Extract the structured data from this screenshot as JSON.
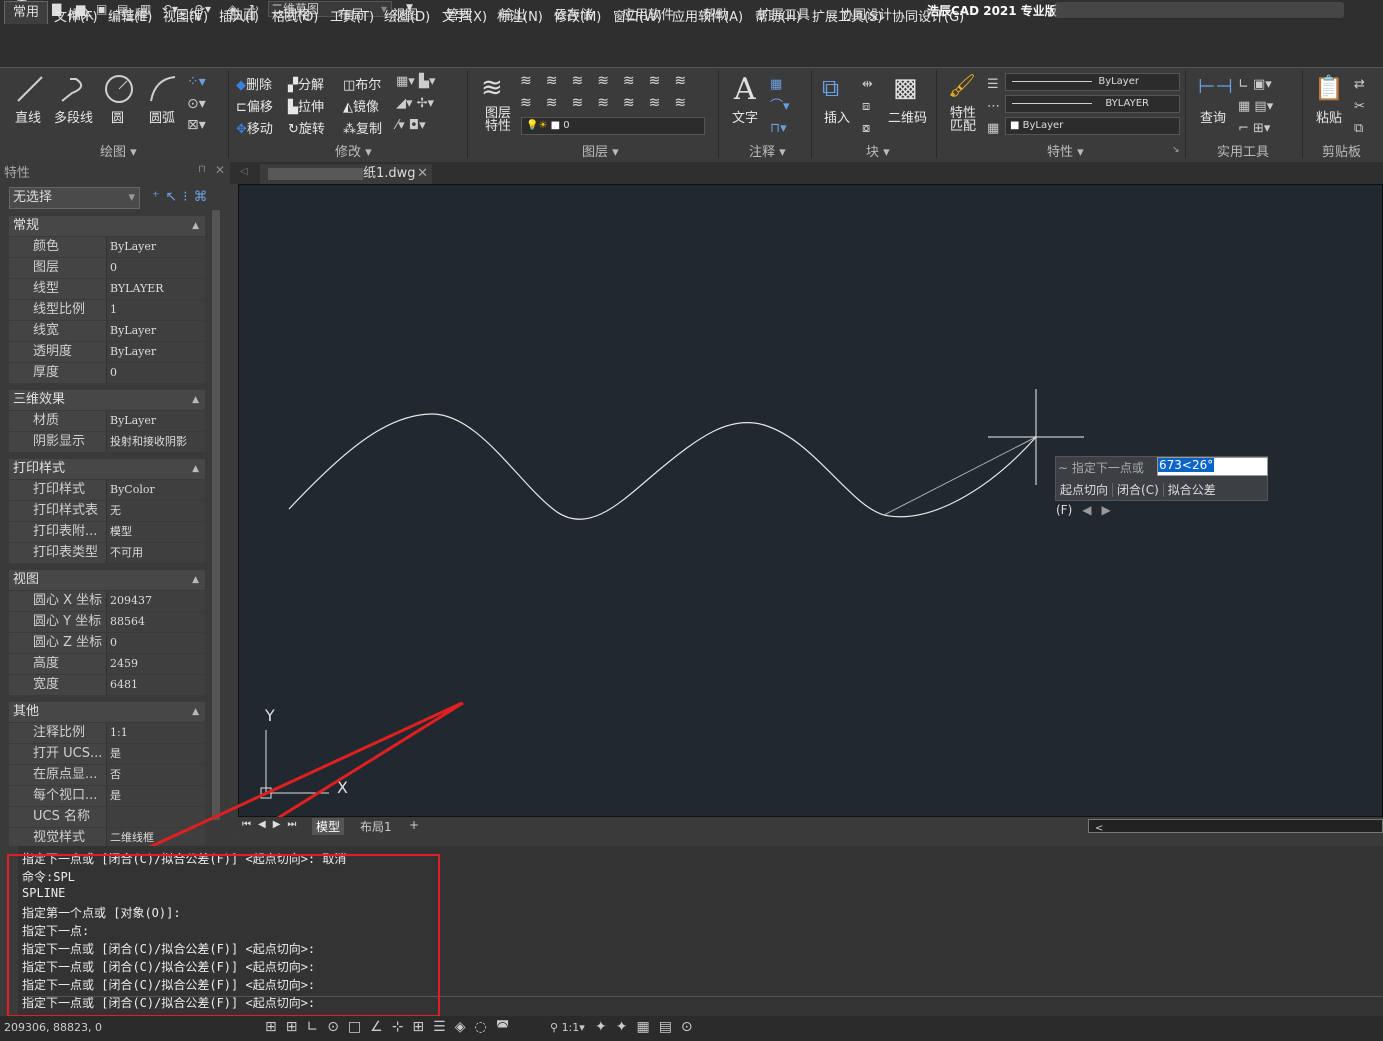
{
  "window": {
    "app_title": "浩辰CAD 2021 专业版",
    "workspace": "二维草图",
    "logo": "G"
  },
  "menu": [
    "文件(F)",
    "编辑(E)",
    "视图(V)",
    "插入(I)",
    "格式(O)",
    "工具(T)",
    "绘图(D)",
    "文字(X)",
    "标注(N)",
    "修改(M)",
    "窗口(W)",
    "应用软件(A)",
    "帮助(H)",
    "扩展工具(S)",
    "协同设计(G)"
  ],
  "tabs": [
    "常用",
    "插入",
    "注释",
    "三维",
    "曲面",
    "网格",
    "布局",
    "视图",
    "管理",
    "输出",
    "云存储",
    "应用软件",
    "帮助",
    "扩展工具",
    "协同设计"
  ],
  "ribbon": {
    "draw": {
      "title": "绘图",
      "line": "直线",
      "pline": "多段线",
      "circle": "圆",
      "arc": "圆弧"
    },
    "modify": {
      "title": "修改",
      "erase": "删除",
      "explode": "分解",
      "boolean": "布尔",
      "offset": "偏移",
      "stretch": "拉伸",
      "mirror": "镜像",
      "move": "移动",
      "rotate": "旋转",
      "copy": "复制"
    },
    "layers": {
      "title": "图层",
      "layer_props_1": "图层",
      "layer_props_2": "特性",
      "layer_value": "0"
    },
    "annotate": {
      "title": "注释",
      "text": "文字"
    },
    "block": {
      "title": "块",
      "insert": "插入",
      "qrcode": "二维码"
    },
    "properties": {
      "title": "特性",
      "match_1": "特性",
      "match_2": "匹配",
      "color": "ByLayer",
      "linetype": "BYLAYER",
      "lineweight": "ByLayer"
    },
    "utilities": {
      "title": "实用工具",
      "query": "查询"
    },
    "clipboard": {
      "title": "剪贴板",
      "paste": "粘贴"
    }
  },
  "properties_panel": {
    "title": "特性",
    "selection": "无选择",
    "sections": [
      {
        "name": "常规",
        "rows": [
          [
            "颜色",
            "ByLayer"
          ],
          [
            "图层",
            "0"
          ],
          [
            "线型",
            "BYLAYER"
          ],
          [
            "线型比例",
            "1"
          ],
          [
            "线宽",
            "ByLayer"
          ],
          [
            "透明度",
            "ByLayer"
          ],
          [
            "厚度",
            "0"
          ]
        ]
      },
      {
        "name": "三维效果",
        "rows": [
          [
            "材质",
            "ByLayer"
          ],
          [
            "阴影显示",
            "投射和接收阴影"
          ]
        ]
      },
      {
        "name": "打印样式",
        "rows": [
          [
            "打印样式",
            "ByColor"
          ],
          [
            "打印样式表",
            "无"
          ],
          [
            "打印表附...",
            "模型"
          ],
          [
            "打印表类型",
            "不可用"
          ]
        ]
      },
      {
        "name": "视图",
        "rows": [
          [
            "圆心 X 坐标",
            "209437"
          ],
          [
            "圆心 Y 坐标",
            "88564"
          ],
          [
            "圆心 Z 坐标",
            "0"
          ],
          [
            "高度",
            "2459"
          ],
          [
            "宽度",
            "6481"
          ]
        ]
      },
      {
        "name": "其他",
        "rows": [
          [
            "注释比例",
            "1:1"
          ],
          [
            "打开 UCS...",
            "是"
          ],
          [
            "在原点显...",
            "否"
          ],
          [
            "每个视口...",
            "是"
          ],
          [
            "UCS 名称",
            ""
          ],
          [
            "视觉样式",
            "二维线框"
          ]
        ]
      }
    ]
  },
  "document": {
    "tab_name": "纸1.dwg"
  },
  "canvas": {
    "prompt_label": "指定下一点或",
    "prompt_value": "673<26°",
    "prompt_options": [
      "起点切向",
      "闭合(C)",
      "拟合公差(F)"
    ],
    "ucs_x": "X",
    "ucs_y": "Y"
  },
  "layout_tabs": [
    "模型",
    "布局1",
    "+"
  ],
  "command_history": [
    "指定下一点或 [闭合(C)/拟合公差(F)] <起点切向>: 取消",
    "命令:SPL",
    "SPLINE",
    "指定第一个点或 [对象(O)]:",
    "指定下一点:",
    "指定下一点或 [闭合(C)/拟合公差(F)] <起点切向>:",
    "指定下一点或 [闭合(C)/拟合公差(F)] <起点切向>:",
    "指定下一点或 [闭合(C)/拟合公差(F)] <起点切向>:",
    "指定下一点或 [闭合(C)/拟合公差(F)] <起点切向>:"
  ],
  "status": {
    "coords": "209306, 88823, 0",
    "scale": "1:1"
  },
  "colors": {
    "canvas_bg": "#212830",
    "highlight": "#0a64c8",
    "annotation_red": "#e02020"
  }
}
